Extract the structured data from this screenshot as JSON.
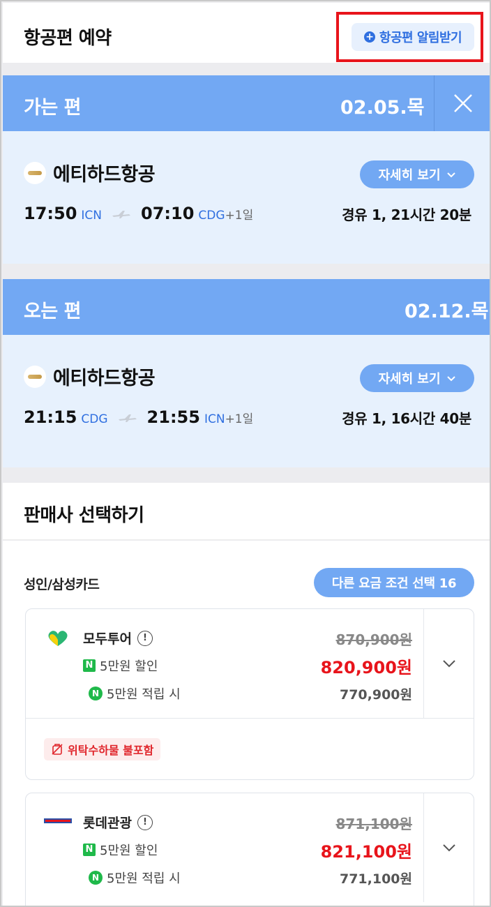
{
  "header": {
    "title": "항공편 예약",
    "alert_button": "항공편 알림받기"
  },
  "outbound": {
    "label": "가는 편",
    "date": "02.05.목",
    "airline": "에티하드항공",
    "detail_button": "자세히 보기",
    "depart_time": "17:50",
    "depart_code": "ICN",
    "arrive_time": "07:10",
    "arrive_code": "CDG",
    "day_offset": "+1일",
    "duration": "경유 1, 21시간 20분"
  },
  "inbound": {
    "label": "오는 편",
    "date": "02.12.목",
    "airline": "에티하드항공",
    "detail_button": "자세히 보기",
    "depart_time": "21:15",
    "depart_code": "CDG",
    "arrive_time": "21:55",
    "arrive_code": "ICN",
    "day_offset": "+1일",
    "duration": "경유 1, 16시간 40분"
  },
  "seller_section": {
    "title": "판매사 선택하기",
    "fare_label": "성인/삼성카드",
    "fare_button": "다른 요금 조건 선택 16"
  },
  "sellers": [
    {
      "name": "모두투어",
      "original_price": "870,900원",
      "discount_label": "5만원 할인",
      "sale_price": "820,900원",
      "point_label": "5만원 적립 시",
      "point_price": "770,900원",
      "baggage_tag": "위탁수하물 불포함"
    },
    {
      "name": "롯데관광",
      "original_price": "871,100원",
      "discount_label": "5만원 할인",
      "sale_price": "821,100원",
      "point_label": "5만원 적립 시",
      "point_price": "771,100원"
    }
  ],
  "colors": {
    "accent_blue": "#72a8f3",
    "link_blue": "#2f6fe0",
    "sale_red": "#e8141b",
    "naver_green": "#1fb94a",
    "highlight_red": "#e8141b"
  }
}
